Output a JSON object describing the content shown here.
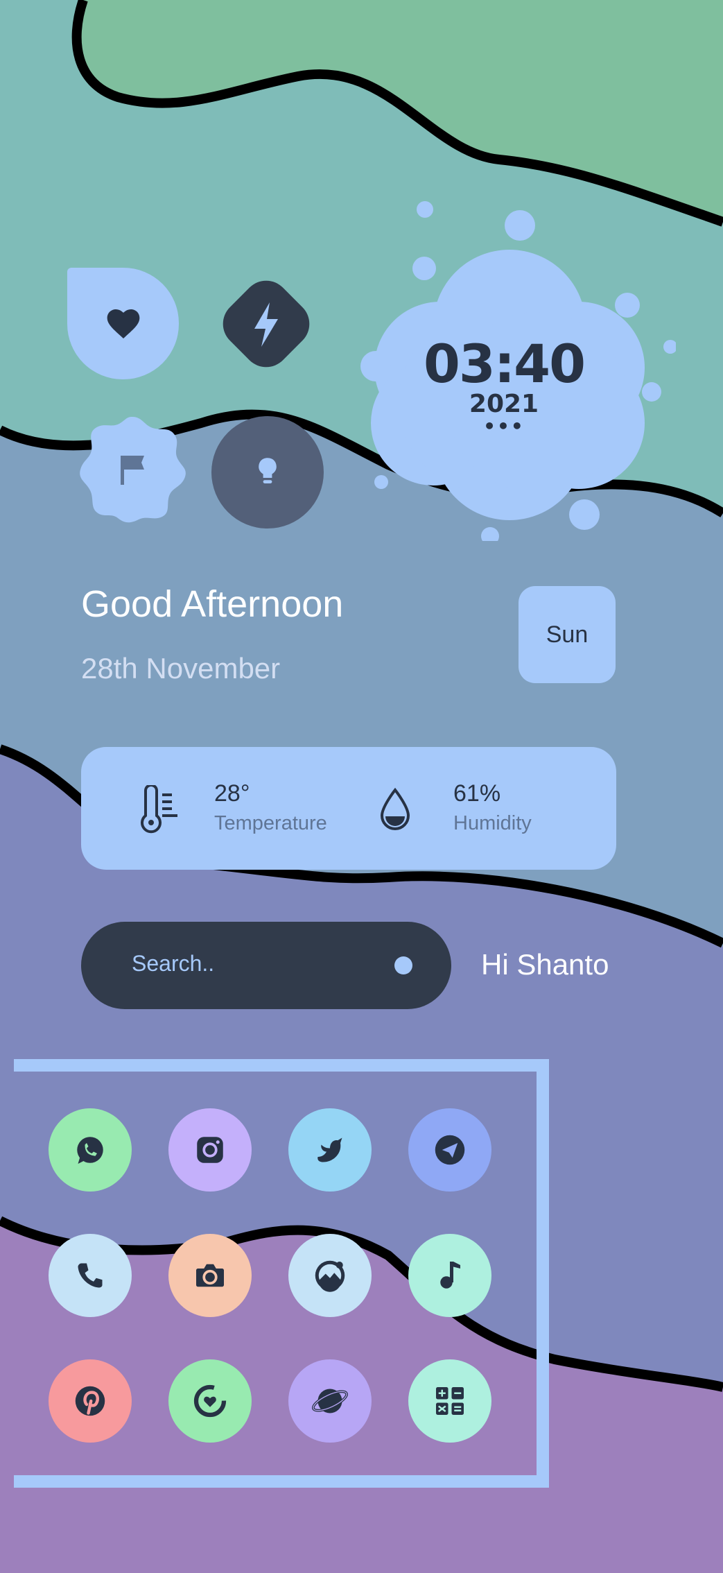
{
  "colors": {
    "accent": "#a6c9fa",
    "dark": "#313b4b",
    "top_band": "#7dbf9e",
    "band2": "#7fa0bf",
    "band3": "#7f88bd",
    "band4": "#9d80bc"
  },
  "quick_toggles": [
    {
      "icon": "heart-icon"
    },
    {
      "icon": "bolt-icon"
    },
    {
      "icon": "flag-icon"
    },
    {
      "icon": "bulb-icon"
    }
  ],
  "clock": {
    "time": "03:40",
    "year": "2021",
    "dots": "•••"
  },
  "greeting": {
    "title": "Good Afternoon",
    "date": "28th November",
    "day": "Sun"
  },
  "weather": {
    "temperature_value": "28°",
    "temperature_label": "Temperature",
    "temperature_icon": "thermometer-icon",
    "humidity_value": "61%",
    "humidity_label": "Humidity",
    "humidity_icon": "water-drop-icon"
  },
  "search": {
    "placeholder": "Search..",
    "greeting": "Hi Shanto"
  },
  "apps": [
    {
      "name": "whatsapp-icon",
      "color": "#98eab0"
    },
    {
      "name": "instagram-icon",
      "color": "#c4b0fb"
    },
    {
      "name": "twitter-icon",
      "color": "#95d5f5"
    },
    {
      "name": "telegram-icon",
      "color": "#8fa8f5"
    },
    {
      "name": "phone-icon",
      "color": "#c5e3f7"
    },
    {
      "name": "camera-icon",
      "color": "#f7c6ad"
    },
    {
      "name": "gallery-icon",
      "color": "#c5e3f7"
    },
    {
      "name": "music-icon",
      "color": "#aef0df"
    },
    {
      "name": "pinterest-icon",
      "color": "#f79a9d"
    },
    {
      "name": "fit-icon",
      "color": "#98eab0"
    },
    {
      "name": "browser-icon",
      "color": "#b7a6f5"
    },
    {
      "name": "calculator-icon",
      "color": "#aef0df"
    }
  ]
}
